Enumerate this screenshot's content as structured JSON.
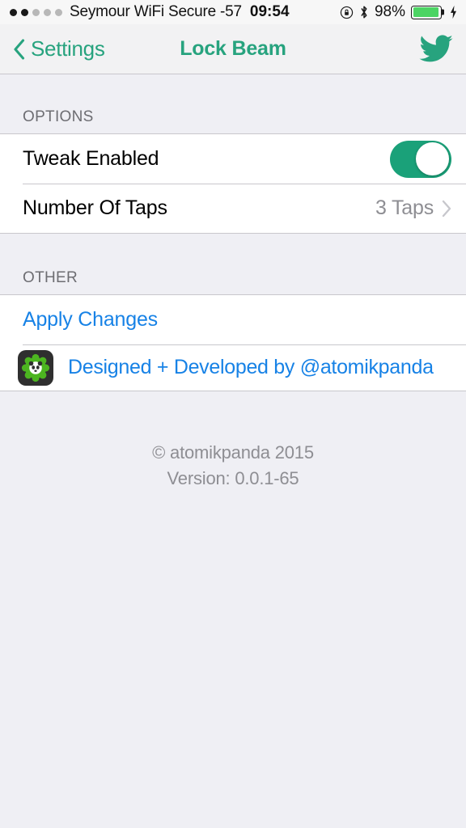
{
  "status_bar": {
    "signal_dots_total": 5,
    "signal_dots_filled": 2,
    "carrier": "Seymour WiFi Secure -57",
    "time": "09:54",
    "battery_percent": "98%",
    "icons": [
      "rotation-lock-icon",
      "bluetooth-icon",
      "battery-icon",
      "charging-bolt-icon"
    ]
  },
  "nav": {
    "back_label": "Settings",
    "title": "Lock Beam",
    "twitter_icon": "twitter-bird-icon",
    "accent_color": "#27a37e"
  },
  "sections": [
    {
      "header": "OPTIONS",
      "rows": [
        {
          "title": "Tweak Enabled",
          "type": "toggle",
          "toggle_on": true,
          "toggle_color": "#1aa179"
        },
        {
          "title": "Number Of Taps",
          "type": "disclosure",
          "value": "3 Taps"
        }
      ]
    },
    {
      "header": "OTHER",
      "rows": [
        {
          "title": "Apply Changes",
          "type": "link",
          "link_color": "#1782e6"
        },
        {
          "title": "Designed + Developed by @atomikpanda",
          "type": "dev-link",
          "icon": "atomikpanda-app-icon",
          "link_color": "#1782e6"
        }
      ]
    }
  ],
  "footer": {
    "copyright": "© atomikpanda 2015",
    "version": "Version: 0.0.1-65"
  }
}
